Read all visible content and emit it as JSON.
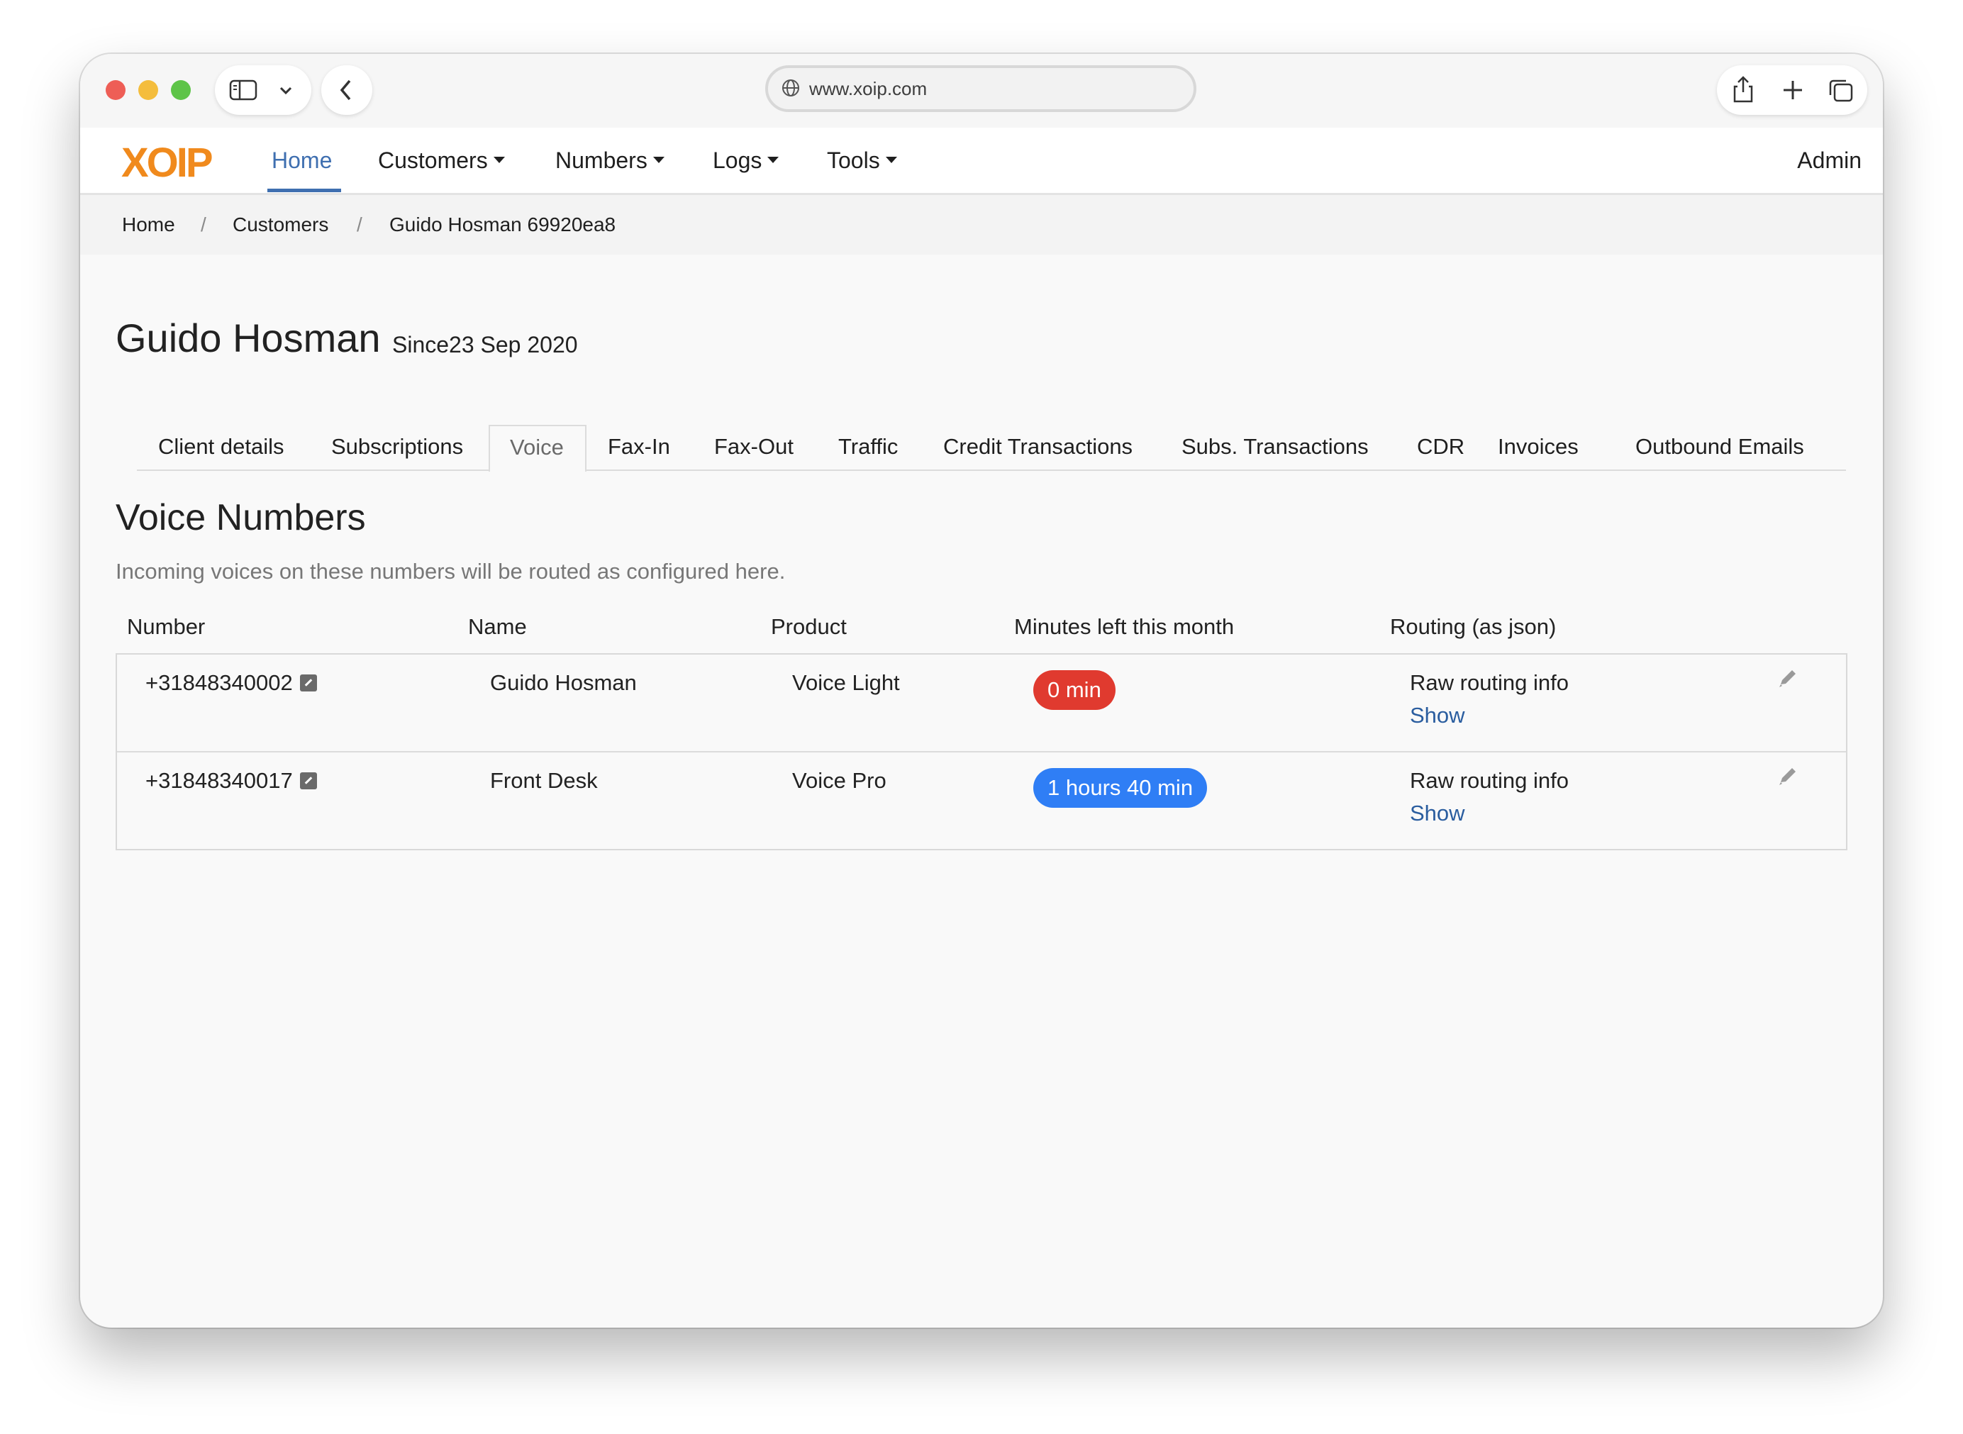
{
  "browser": {
    "url": "www.xoip.com"
  },
  "navbar": {
    "logo": "XOIP",
    "items": [
      "Home",
      "Customers",
      "Numbers",
      "Logs",
      "Tools"
    ],
    "user": "Admin"
  },
  "breadcrumb": [
    "Home",
    "Customers",
    "Guido Hosman 69920ea8"
  ],
  "customer": {
    "name": "Guido Hosman",
    "since": "Since23 Sep 2020"
  },
  "tabs": [
    "Client details",
    "Subscriptions",
    "Voice",
    "Fax-In",
    "Fax-Out",
    "Traffic",
    "Credit Transactions",
    "Subs. Transactions",
    "CDR",
    "Invoices",
    "Outbound Emails"
  ],
  "active_tab": "Voice",
  "section": {
    "title": "Voice Numbers",
    "description": "Incoming voices on these numbers will be routed as configured here."
  },
  "table": {
    "headers": [
      "Number",
      "Name",
      "Product",
      "Minutes left this month",
      "Routing (as json)"
    ],
    "rows": [
      {
        "number": "+31848340002",
        "name": "Guido Hosman",
        "product": "Voice Light",
        "minutes": "0 min",
        "minutes_status": "empty",
        "routing_label": "Raw routing info",
        "routing_link": "Show"
      },
      {
        "number": "+31848340017",
        "name": "Front Desk",
        "product": "Voice Pro",
        "minutes": "1 hours 40 min",
        "minutes_status": "available",
        "routing_label": "Raw routing info",
        "routing_link": "Show"
      }
    ]
  },
  "colors": {
    "brand": "#f08a1d",
    "nav_active": "#3f6fb0",
    "badge_empty": "#e03a2f",
    "badge_available": "#2f7ef5",
    "link": "#2a5d9f"
  }
}
